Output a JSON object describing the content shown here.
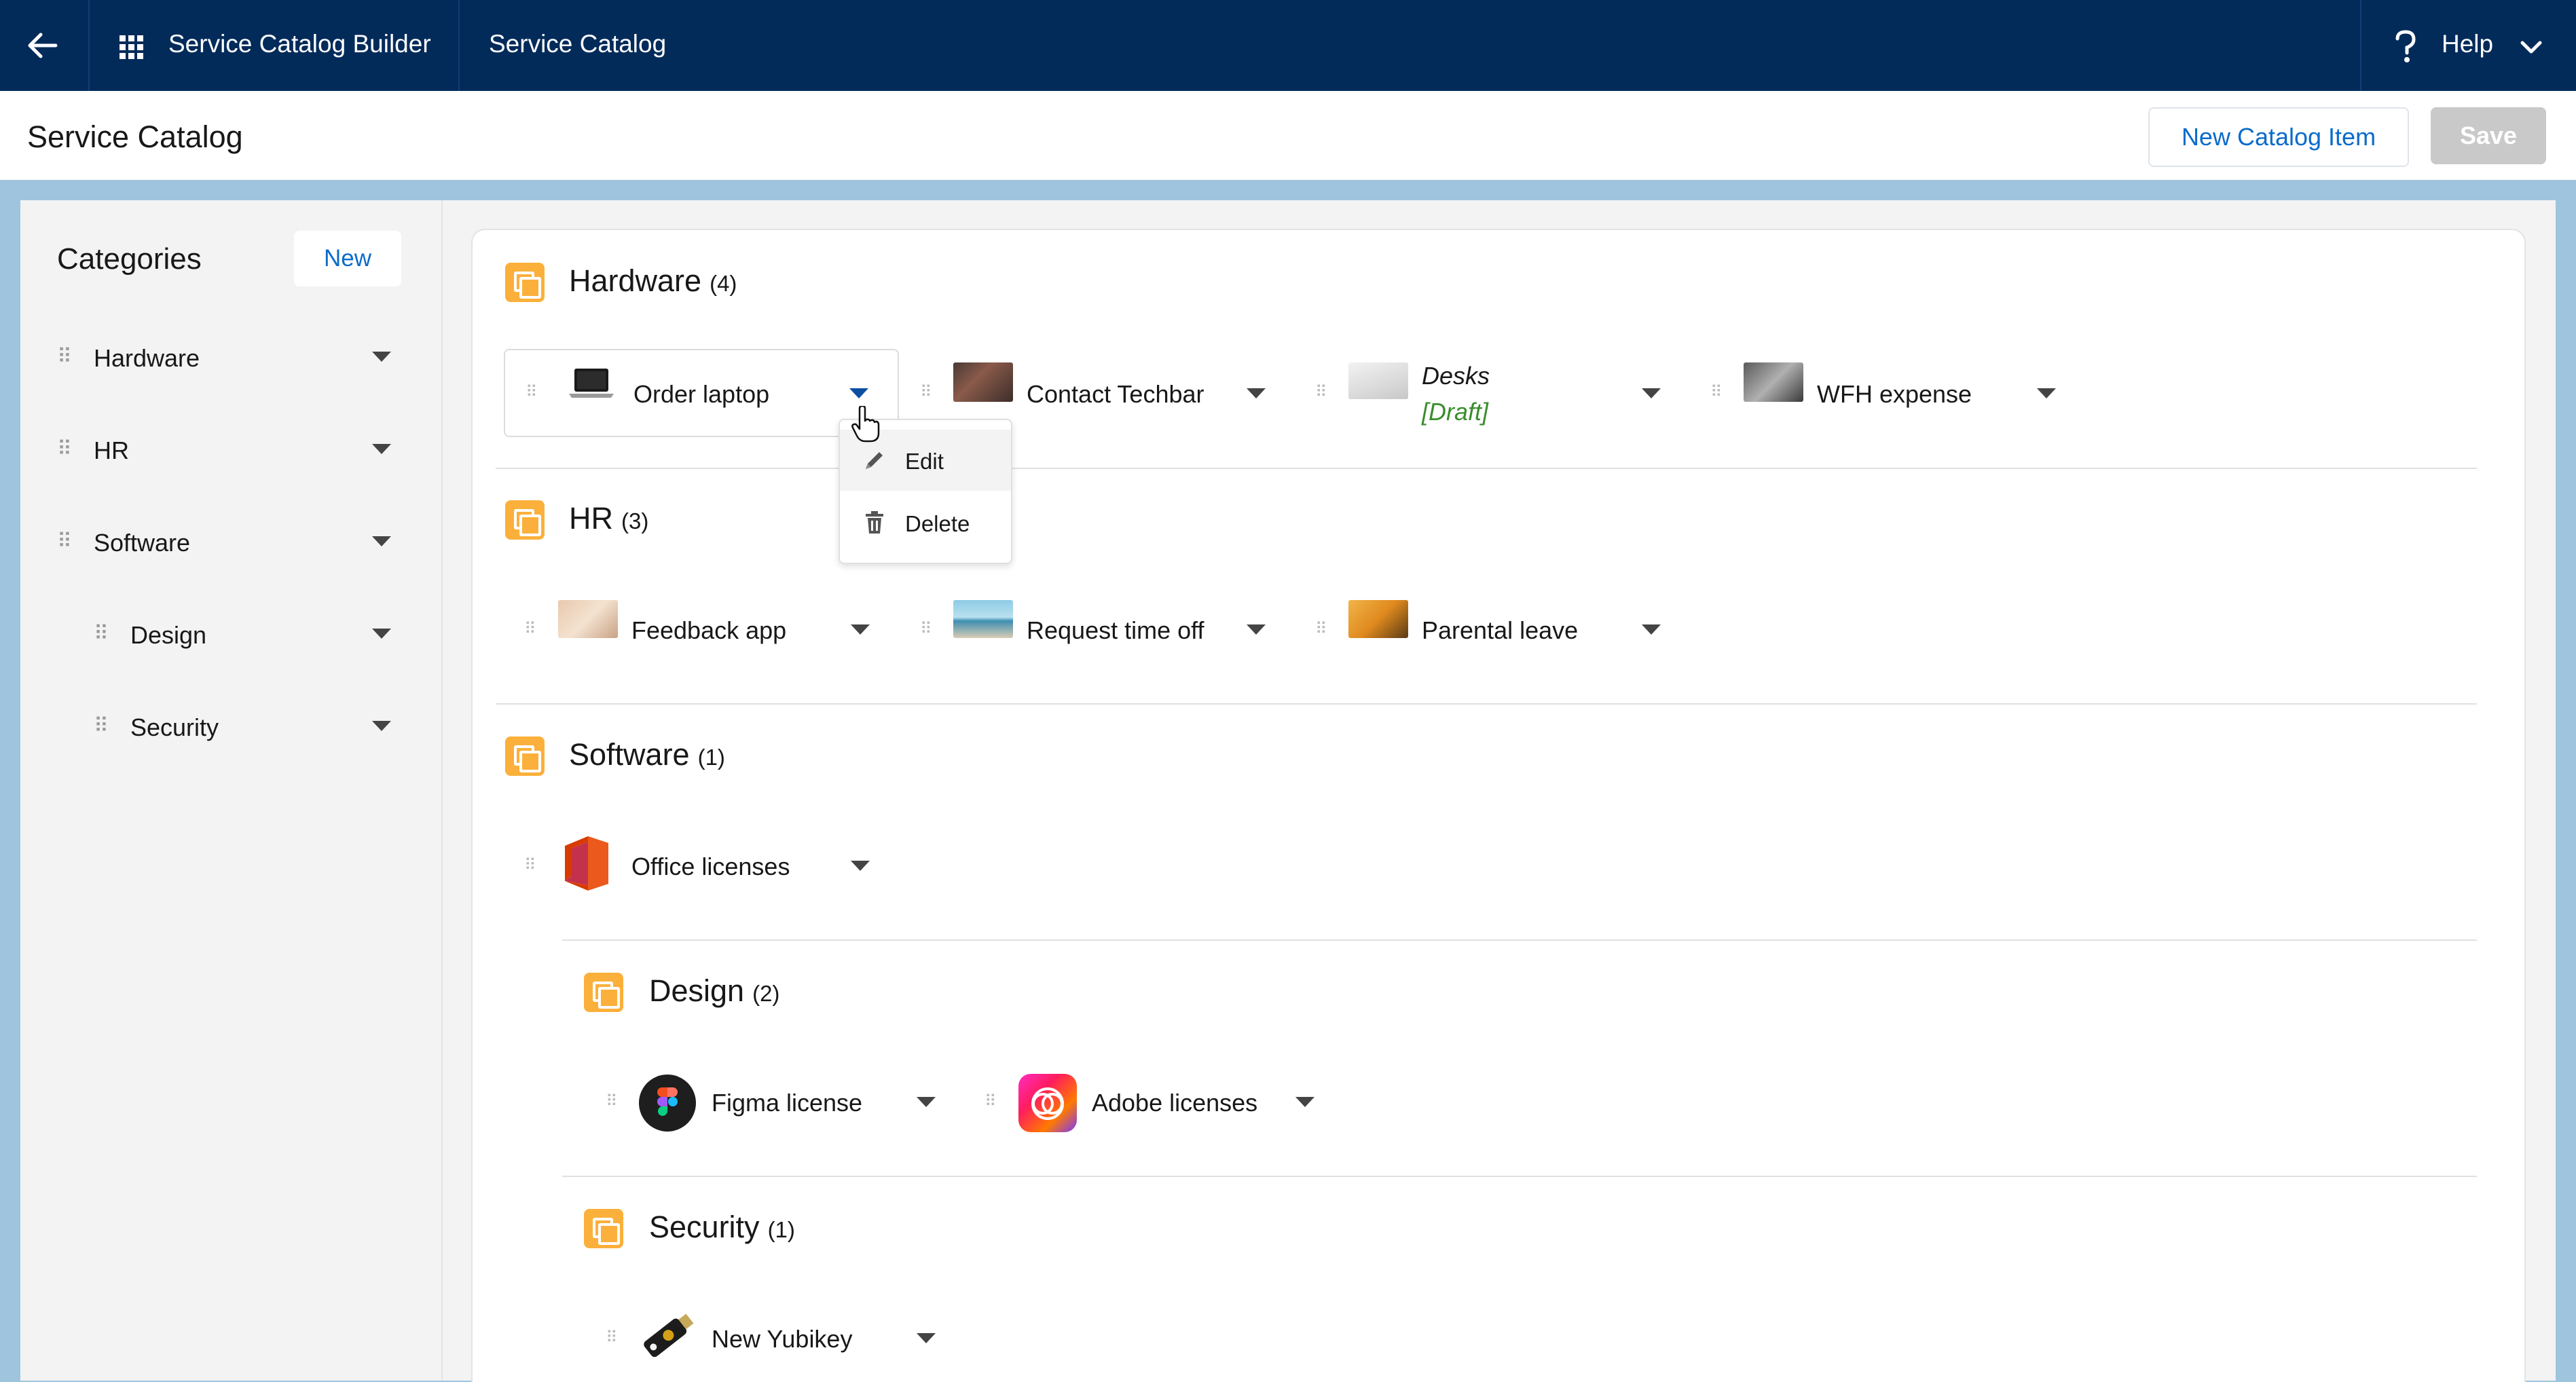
{
  "topbar": {
    "app_name": "Service Catalog Builder",
    "tab": "Service Catalog",
    "help_label": "Help"
  },
  "header": {
    "title": "Service Catalog",
    "new_item_label": "New Catalog Item",
    "save_label": "Save"
  },
  "sidebar": {
    "heading": "Categories",
    "new_label": "New",
    "items": [
      {
        "label": "Hardware"
      },
      {
        "label": "HR"
      },
      {
        "label": "Software"
      },
      {
        "label": "Design"
      },
      {
        "label": "Security"
      }
    ]
  },
  "categories": {
    "hardware": {
      "title": "Hardware",
      "count": "(4)",
      "items": [
        {
          "label": "Order laptop"
        },
        {
          "label": "Contact Techbar"
        },
        {
          "label": "Desks",
          "status": "[Draft]"
        },
        {
          "label": "WFH expense"
        }
      ]
    },
    "hr": {
      "title": "HR",
      "count": "(3)",
      "items": [
        {
          "label": "Feedback app"
        },
        {
          "label": "Request time off"
        },
        {
          "label": "Parental leave"
        }
      ]
    },
    "software": {
      "title": "Software",
      "count": "(1)",
      "items": [
        {
          "label": "Office licenses"
        }
      ]
    },
    "design": {
      "title": "Design",
      "count": "(2)",
      "items": [
        {
          "label": "Figma license"
        },
        {
          "label": "Adobe licenses"
        }
      ]
    },
    "security": {
      "title": "Security",
      "count": "(1)",
      "items": [
        {
          "label": "New Yubikey"
        }
      ]
    }
  },
  "item_menu": {
    "edit_label": "Edit",
    "delete_label": "Delete"
  },
  "colors": {
    "topbar": "#022b5a",
    "category_icon": "#fbb03b",
    "link": "#0b6bcb",
    "draft": "#3a8e2d"
  }
}
